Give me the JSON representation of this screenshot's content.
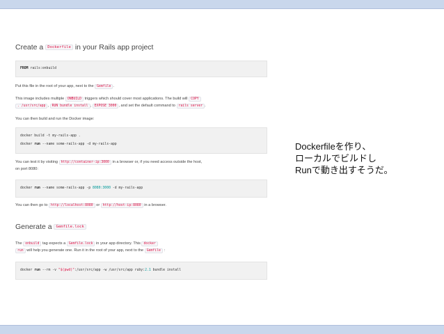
{
  "heading1": {
    "prefix": "Create a",
    "code": "Dockerfile",
    "suffix": "in your Rails app project"
  },
  "code1": {
    "kw": "FROM",
    "rest": " rails:onbuild"
  },
  "para1": {
    "text": "Put this file in the root of your app, next to the",
    "code": "Gemfile",
    "end": "."
  },
  "para2": {
    "t1": "This image includes multiple",
    "c1": "ONBUILD",
    "t2": "triggers which should cover most applications. The build will",
    "c2": "COPY",
    "c3": ". /usr/src/app",
    "t3": ",",
    "c4": "RUN bundle install",
    "t4": ",",
    "c5": "EXPOSE 3000",
    "t5": ", and set the default command to",
    "c6": "rails server",
    "t6": "."
  },
  "para3": {
    "text": "You can then build and run the Docker image:"
  },
  "code2": {
    "l1": "docker build -t my-rails-app .",
    "l2_a": "docker ",
    "l2_kw": "run",
    "l2_b": " --name some-rails-app -d my-rails-app"
  },
  "para4": {
    "t1": "You can test it by visiting",
    "c1": "http://container-ip:3000",
    "t2": "in a browser or, if you need access outside the host,",
    "t3": "on port 8080:"
  },
  "code3": {
    "a": "docker ",
    "kw": "run",
    "b": " --name some-rails-app -p ",
    "num": "8080:3000",
    "c": " -d my-rails-app"
  },
  "para5": {
    "t1": "You can then go to",
    "c1": "http://localhost:8080",
    "t2": "or",
    "c2": "http://host-ip:8080",
    "t3": "in a browser."
  },
  "heading2": {
    "prefix": "Generate a",
    "code": "Gemfile.lock"
  },
  "para6": {
    "t1": "The",
    "c1": "onbuild",
    "t2": "tag expects a",
    "c2": "Gemfile.lock",
    "t3": "in your app directory. This",
    "c3": "docker",
    "c4": "run",
    "t4": "will help you generate one. Run it in the root of your app, next to the",
    "c5": "Gemfile",
    "t5": ":"
  },
  "code4": {
    "a": "docker ",
    "kw": "run",
    "b": " --rm -v ",
    "str": "\"$(pwd)\"",
    "c": ":/usr/src/app -w /usr/src/app ruby:",
    "num": "2.1",
    "d": " bundle install"
  },
  "note": {
    "line1": "Dockerfileを作り、",
    "line2": "ローカルでビルドし",
    "line3": "Runで動き出すそうだ。"
  },
  "colors": {
    "band": "#c9d7ec",
    "code_bg": "#f1f1f1",
    "inline_code": "#d14"
  }
}
